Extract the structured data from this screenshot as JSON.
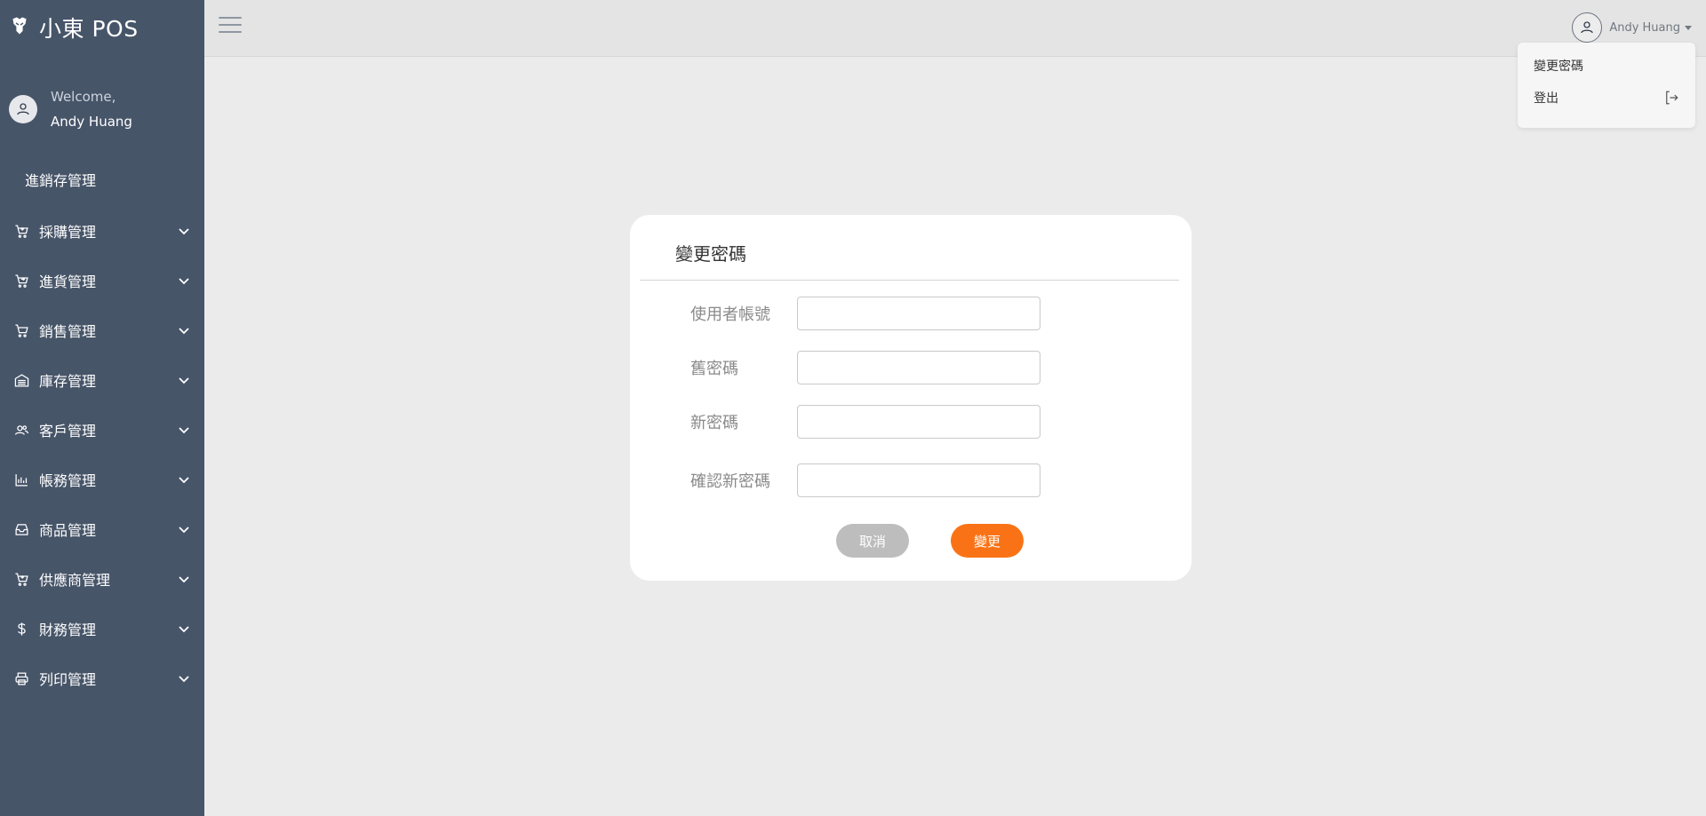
{
  "app": {
    "brand": "小東 POS"
  },
  "user": {
    "welcome": "Welcome,",
    "name": "Andy Huang"
  },
  "sidebar": {
    "section_title": "進銷存管理",
    "items": [
      {
        "label": "採購管理",
        "icon": "cart-plus-icon"
      },
      {
        "label": "進貨管理",
        "icon": "cart-arrow-icon"
      },
      {
        "label": "銷售管理",
        "icon": "cart-icon"
      },
      {
        "label": "庫存管理",
        "icon": "warehouse-icon"
      },
      {
        "label": "客戶管理",
        "icon": "users-icon"
      },
      {
        "label": "帳務管理",
        "icon": "bar-chart-icon"
      },
      {
        "label": "商品管理",
        "icon": "inbox-icon"
      },
      {
        "label": "供應商管理",
        "icon": "cart-plus-icon"
      },
      {
        "label": "財務管理",
        "icon": "dollar-icon"
      },
      {
        "label": "列印管理",
        "icon": "printer-icon"
      }
    ]
  },
  "topbar": {
    "username": "Andy Huang"
  },
  "dropdown": {
    "change_password": "變更密碼",
    "logout": "登出"
  },
  "form": {
    "title": "變更密碼",
    "fields": [
      {
        "label": "使用者帳號",
        "value": ""
      },
      {
        "label": "舊密碼",
        "value": ""
      },
      {
        "label": "新密碼",
        "value": ""
      },
      {
        "label": "確認新密碼",
        "value": ""
      }
    ],
    "cancel_label": "取消",
    "submit_label": "變更"
  },
  "colors": {
    "sidebar_bg": "#475569",
    "accent": "#f97316",
    "cancel": "#bdbdbd"
  }
}
